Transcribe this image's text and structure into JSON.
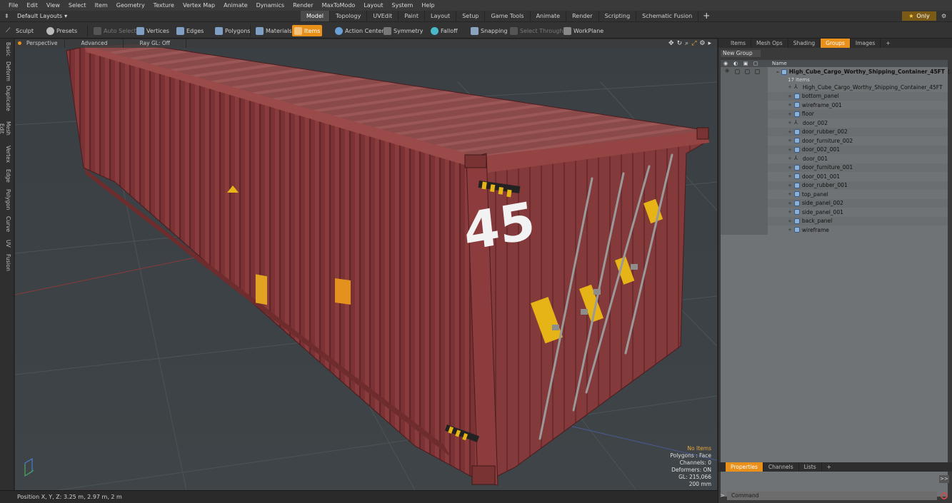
{
  "menu": [
    "File",
    "Edit",
    "View",
    "Select",
    "Item",
    "Geometry",
    "Texture",
    "Vertex Map",
    "Animate",
    "Dynamics",
    "Render",
    "MaxToModo",
    "Layout",
    "System",
    "Help"
  ],
  "layout": {
    "dropdown": "Default Layouts",
    "tabs": [
      "Model",
      "Topology",
      "UVEdit",
      "Paint",
      "Layout",
      "Setup",
      "Game Tools",
      "Animate",
      "Render",
      "Scripting",
      "Schematic Fusion"
    ],
    "active_tab": "Model",
    "only_label": "Only"
  },
  "toolbar": {
    "sculpt": "Sculpt",
    "presets": "Presets",
    "auto_select": "Auto Select",
    "vertices": "Vertices",
    "edges": "Edges",
    "polygons": "Polygons",
    "materials": "Materials",
    "items": "Items",
    "action_center": "Action Center",
    "symmetry": "Symmetry",
    "falloff": "Falloff",
    "snapping": "Snapping",
    "select_through": "Select Through",
    "workplane": "WorkPlane"
  },
  "left_tabs": [
    "Basic",
    "Deform",
    "Duplicate",
    "Mesh Edit",
    "Vertex",
    "Edge",
    "Polygon",
    "Curve",
    "UV",
    "Fusion"
  ],
  "viewport": {
    "view": "Perspective",
    "shading": "Advanced",
    "raygl": "Ray GL: Off",
    "container_number": "45",
    "info": {
      "items": "No Items",
      "polygons": "Polygons : Face",
      "channels": "Channels: 0",
      "deformers": "Deformers: ON",
      "gl": "GL: 215,066",
      "scale": "200 mm"
    }
  },
  "status": {
    "position": "Position X, Y, Z:  3.25 m, 2.97 m, 2 m"
  },
  "right_panel": {
    "tabs": [
      "Items",
      "Mesh Ops",
      "Shading",
      "Groups",
      "Images"
    ],
    "active_tab": "Groups",
    "new_group": "New Group",
    "name_header": "Name",
    "group_name": "High_Cube_Cargo_Worthy_Shipping_Container_45FT",
    "group_suffix": "(...",
    "item_count": "17 Items",
    "items": [
      {
        "name": "High_Cube_Cargo_Worthy_Shipping_Container_45FT",
        "type": "locator"
      },
      {
        "name": "bottom_panel",
        "type": "mesh"
      },
      {
        "name": "wireframe_001",
        "type": "mesh"
      },
      {
        "name": "floor",
        "type": "mesh"
      },
      {
        "name": "door_002",
        "type": "locator"
      },
      {
        "name": "door_rubber_002",
        "type": "mesh"
      },
      {
        "name": "door_furniture_002",
        "type": "mesh"
      },
      {
        "name": "door_002_001",
        "type": "mesh"
      },
      {
        "name": "door_001",
        "type": "locator"
      },
      {
        "name": "door_furniture_001",
        "type": "mesh"
      },
      {
        "name": "door_001_001",
        "type": "mesh"
      },
      {
        "name": "door_rubber_001",
        "type": "mesh"
      },
      {
        "name": "top_panel",
        "type": "mesh"
      },
      {
        "name": "side_panel_002",
        "type": "mesh"
      },
      {
        "name": "side_panel_001",
        "type": "mesh"
      },
      {
        "name": "back_panel",
        "type": "mesh"
      },
      {
        "name": "wireframe",
        "type": "mesh"
      }
    ],
    "bottom_tabs": [
      "Properties",
      "Channels",
      "Lists"
    ],
    "bottom_active": "Properties",
    "command_placeholder": "Command"
  }
}
